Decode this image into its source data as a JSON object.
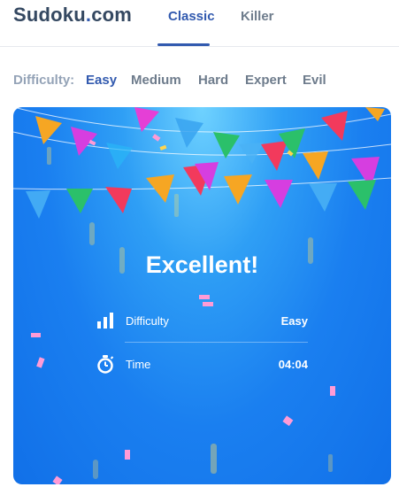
{
  "header": {
    "logo_main": "Sudoku",
    "logo_dot": ".",
    "logo_suffix": "com",
    "tabs": [
      {
        "label": "Classic",
        "active": true
      },
      {
        "label": "Killer",
        "active": false
      }
    ]
  },
  "difficulty": {
    "label": "Difficulty:",
    "options": [
      {
        "label": "Easy",
        "active": true
      },
      {
        "label": "Medium",
        "active": false
      },
      {
        "label": "Hard",
        "active": false
      },
      {
        "label": "Expert",
        "active": false
      },
      {
        "label": "Evil",
        "active": false
      }
    ]
  },
  "result_card": {
    "title": "Excellent!",
    "stats": [
      {
        "icon": "bars-icon",
        "label": "Difficulty",
        "value": "Easy"
      },
      {
        "icon": "stopwatch-icon",
        "label": "Time",
        "value": "04:04"
      }
    ]
  },
  "colors": {
    "brand": "#325aaf",
    "text_dark": "#344861",
    "text_muted": "#6e7c8c",
    "card_blue": "#1a7ff0"
  }
}
